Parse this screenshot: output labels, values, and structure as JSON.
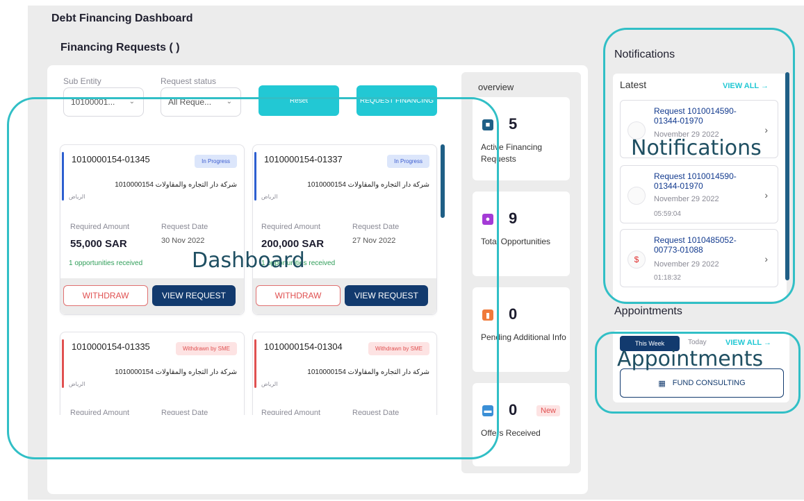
{
  "page": {
    "title": "Debt Financing Dashboard",
    "section": "Financing Requests ( )"
  },
  "filters": {
    "sub_entity_label": "Sub Entity",
    "sub_entity_value": "10100001...",
    "status_label": "Request status",
    "status_value": "All Reque..."
  },
  "buttons": {
    "reset": "Reset",
    "request_financing": "REQUEST FINANCING"
  },
  "requests": [
    {
      "id": "1010000154-01345",
      "status": "In Progress",
      "company": "شركة دار التجاره والمقاولات 1010000154",
      "city": "الرياض",
      "amount_label": "Required Amount",
      "amount": "55,000 SAR",
      "date_label": "Request Date",
      "date": "30 Nov 2022",
      "opportunities": "1 opportunities received",
      "withdraw": "WITHDRAW",
      "view": "VIEW REQUEST"
    },
    {
      "id": "1010000154-01337",
      "status": "In Progress",
      "company": "شركة دار التجاره والمقاولات 1010000154",
      "city": "الرياض",
      "amount_label": "Required Amount",
      "amount": "200,000 SAR",
      "date_label": "Request Date",
      "date": "27 Nov 2022",
      "opportunities": "1 opportunities received",
      "withdraw": "WITHDRAW",
      "view": "VIEW REQUEST"
    },
    {
      "id": "1010000154-01335",
      "status": "Withdrawn by SME",
      "company": "شركة دار التجاره والمقاولات 1010000154",
      "city": "الرياض",
      "amount_label": "Required Amount",
      "date_label": "Request Date"
    },
    {
      "id": "1010000154-01304",
      "status": "Withdrawn by SME",
      "company": "شركة دار التجاره والمقاولات 1010000154",
      "city": "الرياض",
      "amount_label": "Required Amount",
      "date_label": "Request Date"
    }
  ],
  "overview": {
    "title": "overview",
    "stats": [
      {
        "value": "5",
        "label": "Active Financing Requests",
        "icon": "folder-icon",
        "color": "#1f5f86"
      },
      {
        "value": "9",
        "label": "Total Opportunities",
        "icon": "lightbulb-icon",
        "color": "#a43bd6"
      },
      {
        "value": "0",
        "label": "Pending Additional Info",
        "icon": "documents-icon",
        "color": "#f07a3a"
      },
      {
        "value": "0",
        "label": "Offers Received",
        "icon": "offer-icon",
        "color": "#3a8fd6",
        "badge": "New"
      }
    ]
  },
  "notifications": {
    "title": "Notifications",
    "latest": "Latest",
    "view_all": "VIEW ALL →",
    "items": [
      {
        "title": "Request 1010014590-01344-01970",
        "date": "November 29 2022",
        "time": ""
      },
      {
        "title": "Request 1010014590-01344-01970",
        "date": "November 29 2022",
        "time": "05:59:04"
      },
      {
        "title": "Request 1010485052-00773-01088",
        "date": "November 29 2022",
        "time": "01:18:32"
      }
    ]
  },
  "appointments": {
    "title": "Appointments",
    "tab_week": "This Week",
    "tab_today": "Today",
    "view_all": "VIEW ALL →",
    "fund_consulting": "FUND CONSULTING"
  },
  "annotations": {
    "dashboard": "Dashboard",
    "notifications": "Notifications",
    "appointments": "Appointments"
  },
  "colors": {
    "teal": "#22c8d4",
    "navy": "#123a6e",
    "annotation": "#31bfc6"
  }
}
